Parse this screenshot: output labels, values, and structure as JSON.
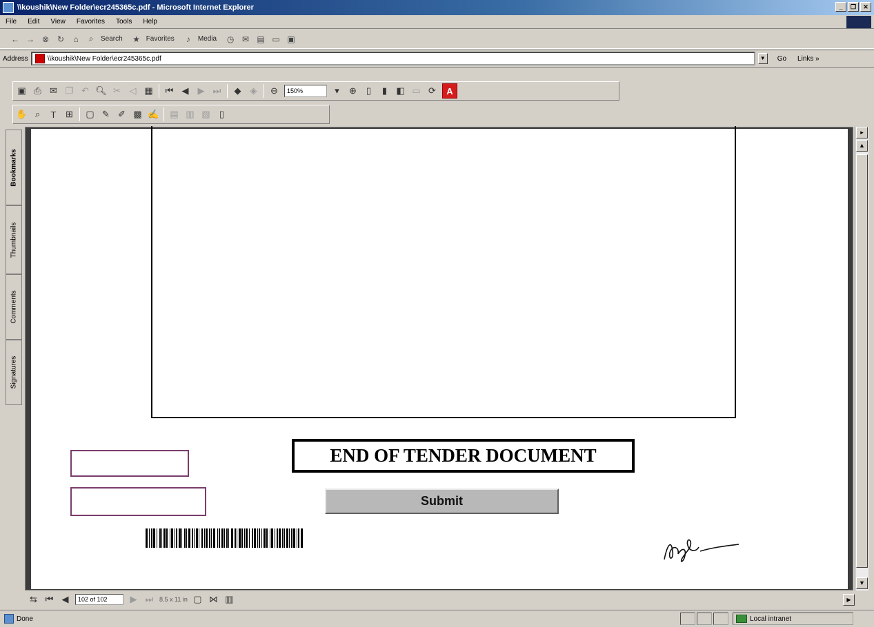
{
  "window": {
    "title": "\\\\koushik\\New Folder\\ecr245365c.pdf - Microsoft Internet Explorer",
    "controls": [
      "_",
      "❐",
      "✕"
    ]
  },
  "menu": [
    "File",
    "Edit",
    "View",
    "Favorites",
    "Tools",
    "Help"
  ],
  "std_toolbar": {
    "search": "Search",
    "favorites": "Favorites",
    "media": "Media"
  },
  "address": {
    "label": "Address",
    "value": "\\\\koushik\\New Folder\\ecr245365c.pdf",
    "go": "Go",
    "links": "Links »"
  },
  "acrobat": {
    "zoom": "150%"
  },
  "sidetabs": [
    "Bookmarks",
    "Thumbnails",
    "Comments",
    "Signatures"
  ],
  "document": {
    "end_title": "END OF TENDER DOCUMENT",
    "submit_label": "Submit"
  },
  "nav": {
    "page": "102 of 102",
    "page_size": "8.5 x 11 in"
  },
  "status": {
    "done": "Done",
    "zone": "Local intranet"
  }
}
